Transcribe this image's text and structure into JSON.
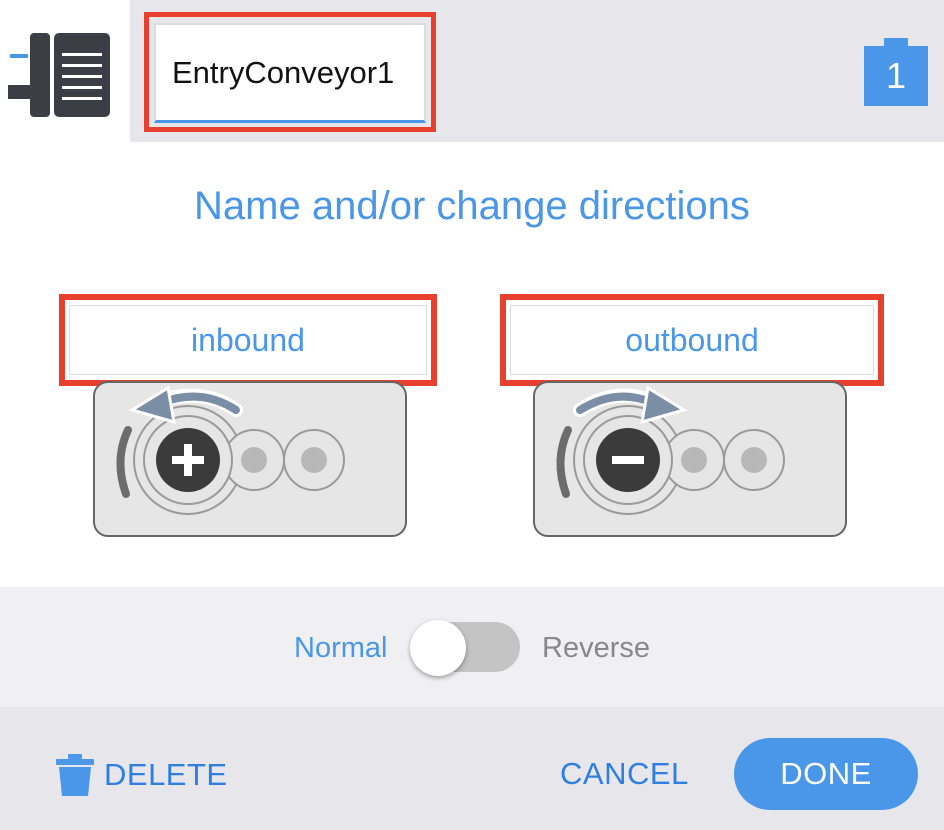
{
  "header": {
    "device_icon": "conveyor-device-icon",
    "name_value": "EntryConveyor1",
    "port_badge": "1"
  },
  "main": {
    "title": "Name and/or change directions",
    "inbound_label": "inbound",
    "outbound_label": "outbound"
  },
  "toggle": {
    "normal_label": "Normal",
    "reverse_label": "Reverse",
    "state": "Normal"
  },
  "footer": {
    "delete_label": "DELETE",
    "cancel_label": "CANCEL",
    "done_label": "DONE"
  },
  "colors": {
    "accent": "#4a97ea",
    "highlight": "#e8402f",
    "icon_dark": "#3b3f45"
  }
}
